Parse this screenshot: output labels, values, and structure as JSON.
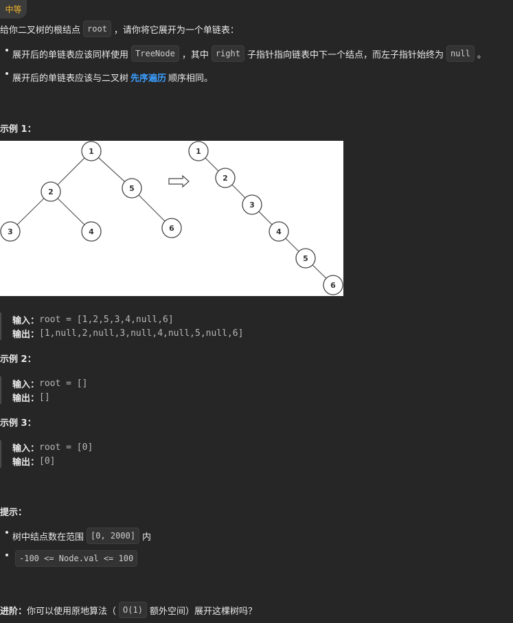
{
  "difficulty": "中等",
  "intro": {
    "pre": "给你二叉树的根结点",
    "code": "root",
    "post": "，请你将它展开为一个单链表："
  },
  "bullets": [
    {
      "a": "展开后的单链表应该同样使用",
      "code1": "TreeNode",
      "b": "，其中",
      "code2": "right",
      "c": "子指针指向链表中下一个结点，而左子指针始终为",
      "code3": "null",
      "d": "。"
    },
    {
      "a": "展开后的单链表应该与二叉树",
      "link": "先序遍历",
      "b": "顺序相同。"
    }
  ],
  "examples": [
    {
      "title": "示例 1：",
      "input_label": "输入：",
      "input": "root = [1,2,5,3,4,null,6]",
      "output_label": "输出：",
      "output": "[1,null,2,null,3,null,4,null,5,null,6]"
    },
    {
      "title": "示例 2：",
      "input_label": "输入：",
      "input": "root = []",
      "output_label": "输出：",
      "output": "[]"
    },
    {
      "title": "示例 3：",
      "input_label": "输入：",
      "input": "root = [0]",
      "output_label": "输出：",
      "output": "[0]"
    }
  ],
  "diagram": {
    "tree_nodes": [
      "1",
      "2",
      "5",
      "3",
      "4",
      "6"
    ],
    "list_nodes": [
      "1",
      "2",
      "3",
      "4",
      "5",
      "6"
    ]
  },
  "hints": {
    "title": "提示：",
    "item1_pre": "树中结点数在范围",
    "item1_code": "[0, 2000]",
    "item1_post": "内",
    "item2_code": "-100 <= Node.val <= 100"
  },
  "advanced": {
    "label": "进阶：",
    "pre": "你可以使用原地算法（",
    "code": "O(1)",
    "post": "额外空间）展开这棵树吗？"
  }
}
